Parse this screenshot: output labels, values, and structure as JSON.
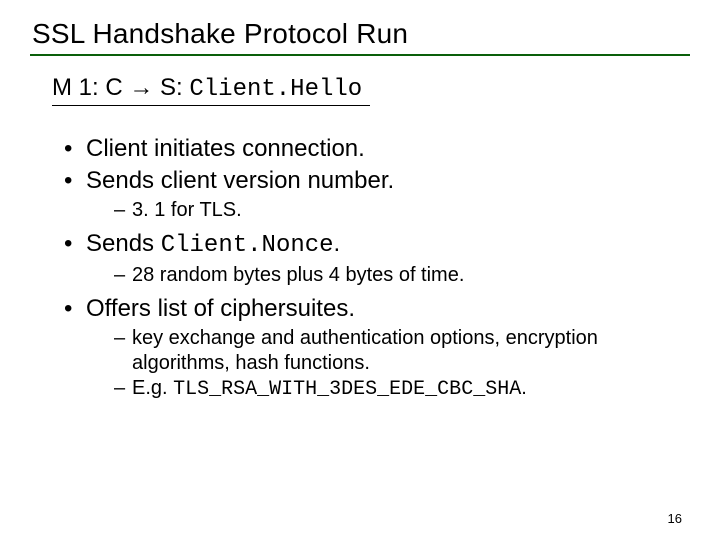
{
  "title": "SSL Handshake Protocol Run",
  "m1": {
    "prefix": "M 1: C ",
    "arrow": "→",
    "mid": " S: ",
    "mono": "Client.Hello"
  },
  "bullets": {
    "b1": "Client initiates connection.",
    "b2": "Sends client version number.",
    "b2s1": "3. 1 for TLS.",
    "b3a": "Sends ",
    "b3mono": "Client.Nonce",
    "b3b": ".",
    "b3s1": "28 random bytes plus 4 bytes of time.",
    "b4": "Offers list of ciphersuites.",
    "b4s1": "key exchange and authentication options, encryption algorithms, hash functions.",
    "b4s2a": "E.g. ",
    "b4s2mono": "TLS_RSA_WITH_3DES_EDE_CBC_SHA",
    "b4s2b": "."
  },
  "page_number": "16"
}
